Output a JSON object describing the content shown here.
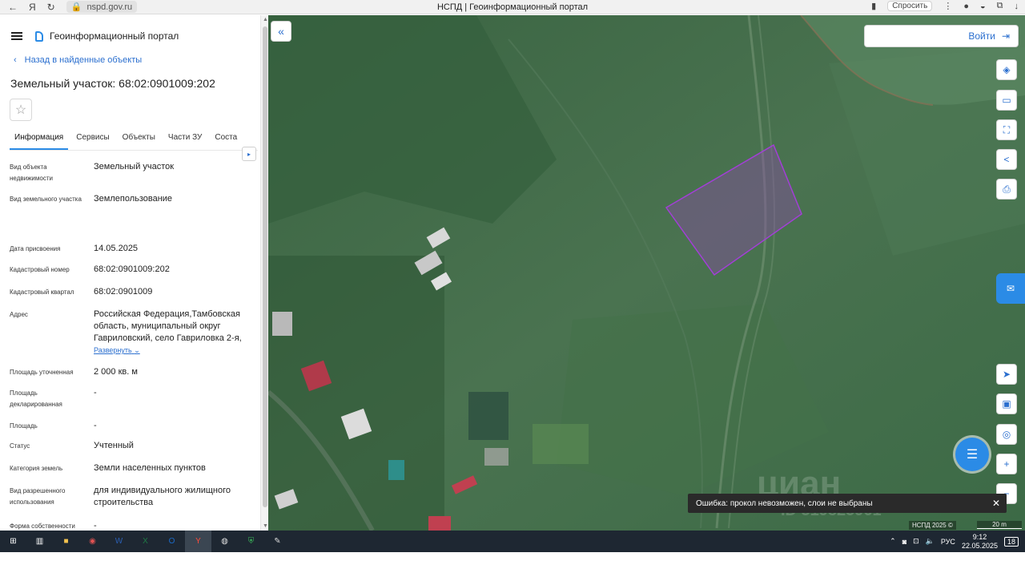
{
  "browser": {
    "url": "nspd.gov.ru",
    "tab_title": "НСПД | Геоинформационный портал",
    "ask_label": "Спросить"
  },
  "panel": {
    "portal_name": "Геоинформационный портал",
    "back_link": "Назад в найденные объекты",
    "object_title": "Земельный участок: 68:02:0901009:202",
    "tabs": [
      "Информация",
      "Сервисы",
      "Объекты",
      "Части ЗУ",
      "Соста"
    ],
    "fields": [
      {
        "label": "Вид объекта недвижимости",
        "value": "Земельный участок"
      },
      {
        "label": "Вид земельного участка",
        "value": "Землепользование"
      },
      {
        "label": "Дата присвоения",
        "value": "14.05.2025"
      },
      {
        "label": "Кадастровый номер",
        "value": "68:02:0901009:202"
      },
      {
        "label": "Кадастровый квартал",
        "value": "68:02:0901009"
      },
      {
        "label": "Адрес",
        "value": "Российская Федерация,Тамбовская область, муниципальный округ Гавриловский, село Гавриловка 2-я,"
      },
      {
        "label": "Площадь уточненная",
        "value": "2 000 кв. м"
      },
      {
        "label": "Площадь декларированная",
        "value": "-"
      },
      {
        "label": "Площадь",
        "value": "-"
      },
      {
        "label": "Статус",
        "value": "Учтенный"
      },
      {
        "label": "Категория земель",
        "value": "Земли населенных пунктов"
      },
      {
        "label": "Вид разрешенного использования",
        "value": "для индивидуального жилищного строительства"
      },
      {
        "label": "Форма собственности",
        "value": "-"
      }
    ],
    "expand_label": "Развернуть"
  },
  "map": {
    "login_label": "Войти",
    "toast": "Ошибка: прокол невозможен, слои не выбраны",
    "attribution": "НСПД 2025 ©",
    "scale": "20 m",
    "watermark": "циан",
    "watermark_id": "ID 319825961",
    "parcel_color": "#a23fd6"
  },
  "taskbar": {
    "tray_lang": "РУС",
    "time": "9:12",
    "date": "22.05.2025",
    "notif_count": "18"
  }
}
